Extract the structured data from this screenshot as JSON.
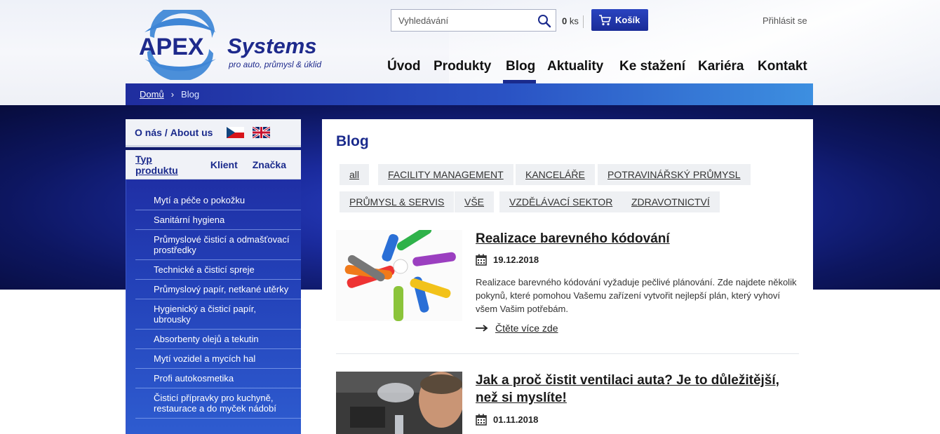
{
  "header": {
    "logo_brand": "APEX",
    "logo_brand_2": "Systems",
    "logo_tagline": "pro auto, průmysl & úklid",
    "search_placeholder": "Vyhledávání",
    "cart_count": "0",
    "cart_unit": "ks",
    "cart_label": "Košík",
    "login_label": "Přihlásit se"
  },
  "nav": {
    "items": [
      "Úvod",
      "Produkty",
      "Blog",
      "Aktuality",
      "Ke stažení",
      "Kariéra",
      "Kontakt"
    ],
    "active": "Blog"
  },
  "breadcrumb": {
    "home": "Domů",
    "separator": "›",
    "current": "Blog"
  },
  "sidebar": {
    "about_label_cz": "O nás",
    "about_sep": "/",
    "about_label_en": "About us",
    "tabs": [
      "Typ produktu",
      "Klient",
      "Značka"
    ],
    "active_tab": "Typ produktu",
    "items": [
      "Mytí a péče o pokožku",
      "Sanitární hygiena",
      "Průmyslové čisticí a odmašťovací prostředky",
      "Technické a čisticí spreje",
      "Průmyslový papír, netkané utěrky",
      "Hygienický a čisticí papír, ubrousky",
      "Absorbenty olejů a tekutin",
      "Mytí vozidel a mycích hal",
      "Profi autokosmetika",
      "Čisticí přípravky pro kuchyně, restaurace a do myček nádobí"
    ]
  },
  "content": {
    "title": "Blog",
    "tags": [
      "all",
      "FACILITY MANAGEMENT",
      "KANCELÁŘE",
      "POTRAVINÁŘSKÝ PRŮMYSL",
      "PRŮMYSL & SERVIS",
      "VŠE",
      "VZDĚLÁVACÍ SEKTOR",
      "ZDRAVOTNICTVÍ"
    ],
    "posts": [
      {
        "title": "Realizace barevného kódování",
        "date": "19.12.2018",
        "text": "Realizace barevného kódování vyžaduje pečlivé plánování. Zde najdete několik pokynů, které pomohou Vašemu zařízení vytvořit nejlepší plán, který vyhoví všem Vašim potřebám.",
        "more": "Čtěte více zde"
      },
      {
        "title": "Jak a proč čistit ventilaci auta? Je to důležitější, než si myslíte!",
        "date": "01.11.2018"
      }
    ]
  },
  "colors": {
    "brand_blue": "#1a2a8c",
    "accent_blue": "#2a52c4",
    "tag_bg": "#eef0f3"
  }
}
